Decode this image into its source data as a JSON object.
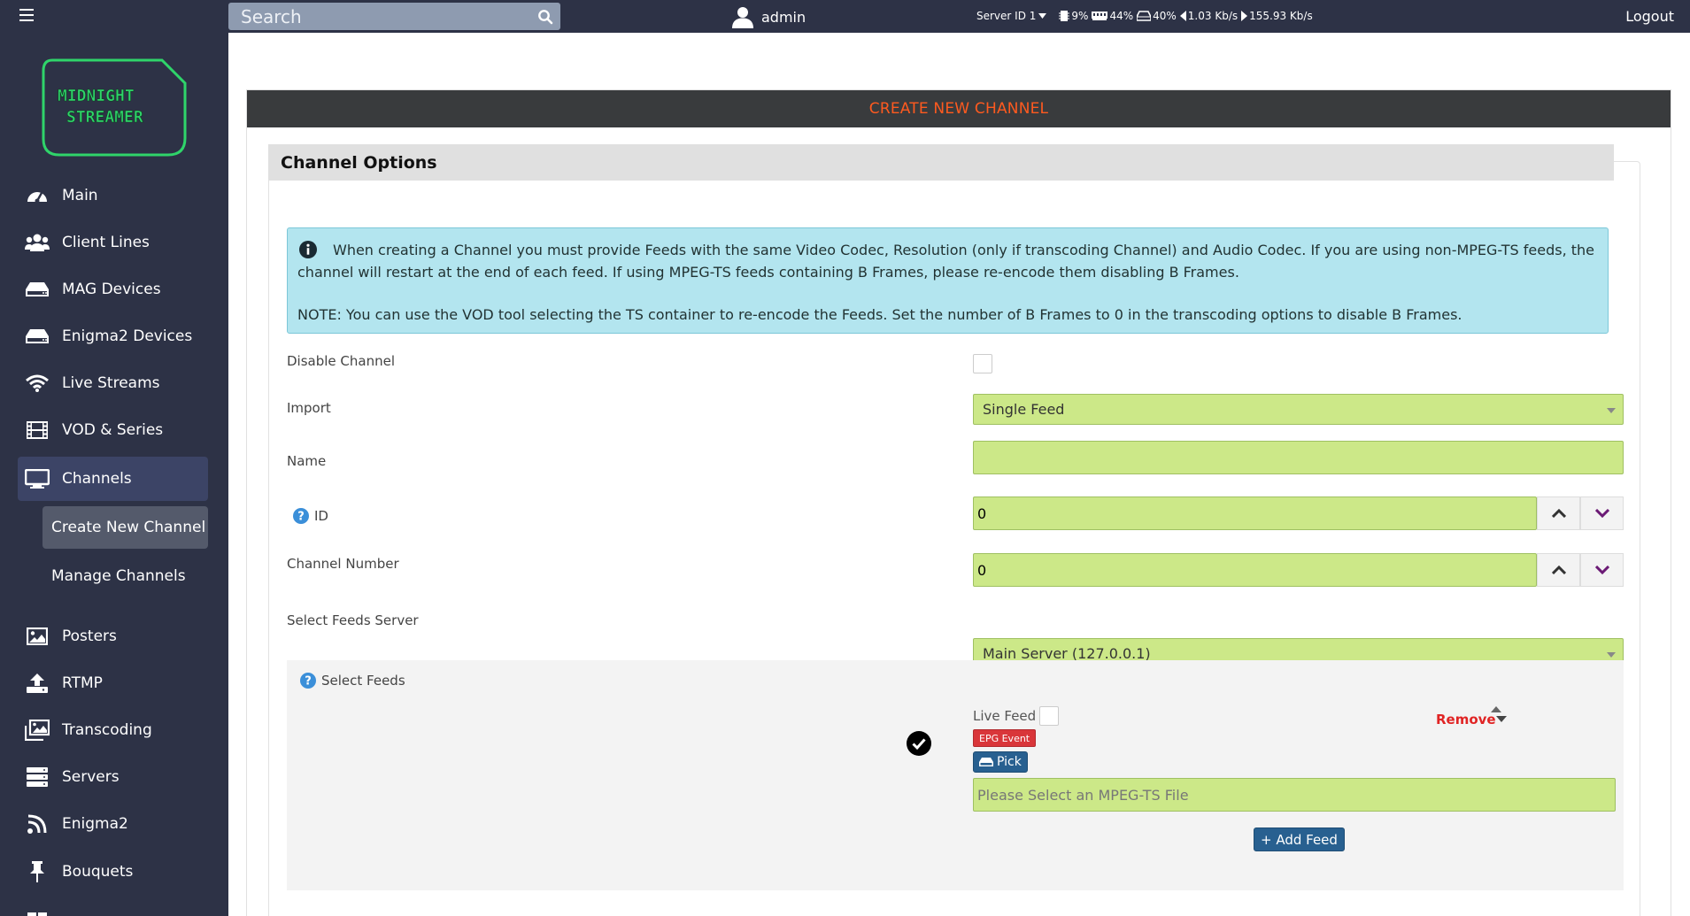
{
  "topbar": {
    "search_placeholder": "Search",
    "user_name": "admin",
    "server_id": "Server ID 1",
    "cpu": "9%",
    "ram": "44%",
    "disk": "40%",
    "net_in": "1.03 Kb/s",
    "net_out": "155.93 Kb/s",
    "logout": "Logout"
  },
  "sidebar": {
    "logo_text": [
      "MIDNIGHT",
      "STREAMER"
    ],
    "items": [
      {
        "label": "Main",
        "icon": "dashboard-icon"
      },
      {
        "label": "Client Lines",
        "icon": "users-icon"
      },
      {
        "label": "MAG Devices",
        "icon": "hdd-icon"
      },
      {
        "label": "Enigma2 Devices",
        "icon": "hdd-icon"
      },
      {
        "label": "Live Streams",
        "icon": "wifi-icon"
      },
      {
        "label": "VOD & Series",
        "icon": "film-icon"
      },
      {
        "label": "Channels",
        "icon": "monitor-icon"
      },
      {
        "label": "Posters",
        "icon": "image-icon"
      },
      {
        "label": "RTMP",
        "icon": "upload-icon"
      },
      {
        "label": "Transcoding",
        "icon": "images-icon"
      },
      {
        "label": "Servers",
        "icon": "server-icon"
      },
      {
        "label": "Enigma2",
        "icon": "satellite-icon"
      },
      {
        "label": "Bouquets",
        "icon": "pin-icon"
      }
    ],
    "sub_items": [
      {
        "label": "Create New Channel"
      },
      {
        "label": "Manage Channels"
      }
    ]
  },
  "page": {
    "card_title": "CREATE NEW CHANNEL",
    "section_title": "Channel Options",
    "info_text": "When creating a Channel you must provide Feeds with the same Video Codec, Resolution (only if transcoding Channel) and Audio Codec. If you are using non-MPEG-TS feeds, the channel will restart at the end of each feed. If using MPEG-TS feeds containing B Frames, please re-encode them disabling B Frames.",
    "info_note": "NOTE: You can use the VOD tool selecting the TS container to re-encode the Feeds. Set the number of B Frames to 0 in the transcoding options to disable B Frames."
  },
  "form": {
    "disable_label": "Disable Channel",
    "import_label": "Import",
    "import_value": "Single Feed",
    "name_label": "Name",
    "name_value": "",
    "id_label": "ID",
    "id_value": "0",
    "channel_number_label": "Channel Number",
    "channel_number_value": "0",
    "feeds_server_label": "Select Feeds Server",
    "feeds_server_value": "Main Server (127.0.0.1)",
    "select_feeds_label": "Select Feeds",
    "live_feed_label": "Live Feed",
    "epg_button": "EPG Event",
    "pick_button": "Pick",
    "mpeg_placeholder": "Please Select an MPEG-TS File",
    "remove_label": "Remove",
    "add_feed_button": "+ Add Feed"
  },
  "colors": {
    "sidebar_bg": "#2d3246",
    "accent_title": "#ff5a1f",
    "input_bg": "#cce888",
    "info_bg": "#b3e5ef"
  }
}
